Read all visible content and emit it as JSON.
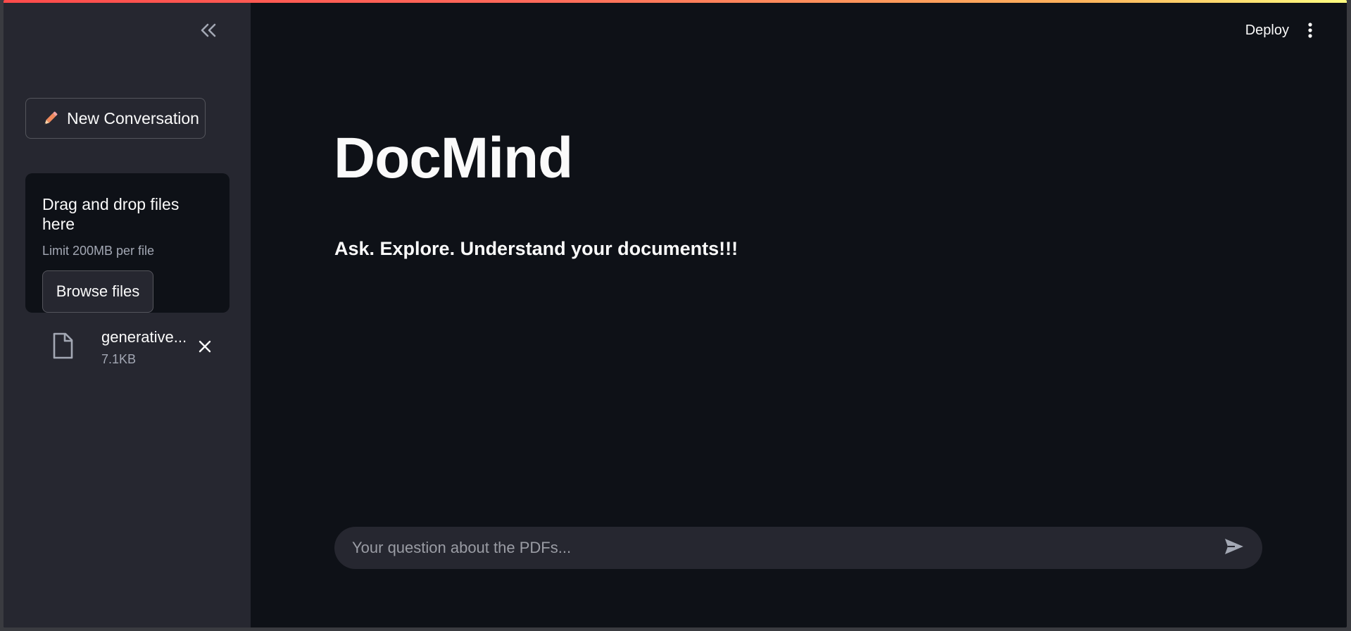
{
  "sidebar": {
    "collapse_icon": "double-chevron-left-icon",
    "new_conversation": {
      "icon": "pencil-icon",
      "label": "New Conversation"
    },
    "uploader": {
      "title": "Drag and drop files here",
      "limit": "Limit 200MB per file",
      "browse_label": "Browse files"
    },
    "files": [
      {
        "icon": "file-icon",
        "name": "generative...",
        "size": "7.1KB",
        "remove_icon": "close-icon"
      }
    ]
  },
  "header": {
    "deploy_label": "Deploy",
    "menu_icon": "vertical-ellipsis-icon"
  },
  "main": {
    "title": "DocMind",
    "subtitle": "Ask. Explore. Understand your documents!!!"
  },
  "chat": {
    "placeholder": "Your question about the PDFs...",
    "value": "",
    "send_icon": "send-icon"
  },
  "colors": {
    "main_bg": "#0e1117",
    "sidebar_bg": "#262730",
    "text": "#fafafa",
    "muted_text": "#a3a8b4",
    "accent_top_bar_start": "#ff4b4b",
    "accent_top_bar_end": "#fffd80",
    "pencil": "#f08a5d"
  }
}
